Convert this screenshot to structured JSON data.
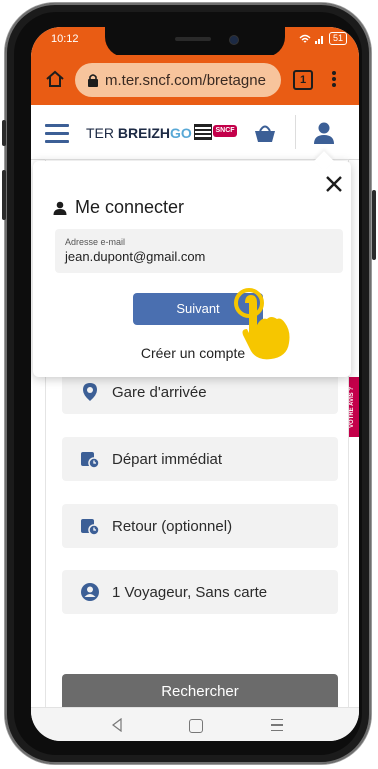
{
  "status_bar": {
    "time": "10:12",
    "battery": "51"
  },
  "browser": {
    "url": "m.ter.sncf.com/bretagne",
    "tab_count": "1"
  },
  "site_header": {
    "brand_prefix": "TER ",
    "brand_name": "BREIZH",
    "brand_suffix": "GO",
    "sncf_badge": "SNCF"
  },
  "login_popup": {
    "title": "Me connecter",
    "email_label": "Adresse e-mail",
    "email_value": "jean.dupont@gmail.com",
    "next_button": "Suivant",
    "create_account": "Créer un compte"
  },
  "booking_form": {
    "arrival_station": "Gare d'arrivée",
    "departure": "Départ immédiat",
    "return": "Retour (optionnel)",
    "travellers": "1 Voyageur, Sans carte",
    "search_button": "Rechercher"
  },
  "feedback_tab": "VOTRE AVIS ?",
  "colors": {
    "browser_orange": "#e95c14",
    "brand_blue": "#3c5f96",
    "button_blue": "#4a6fb0",
    "sncf_magenta": "#c3004a",
    "tap_yellow": "#f6c600"
  }
}
